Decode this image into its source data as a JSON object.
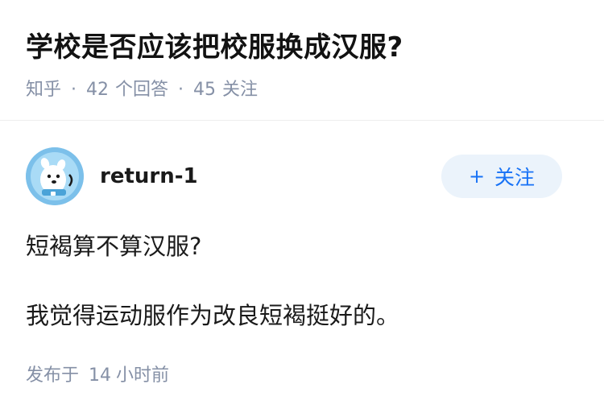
{
  "question": {
    "title": "学校是否应该把校服换成汉服?",
    "source": "知乎",
    "separator": "·",
    "answer_count": "42",
    "answer_label": "个回答",
    "follow_count": "45",
    "follow_label": "关注"
  },
  "answer": {
    "author": "return-1",
    "follow_button": {
      "icon": "+",
      "label": "关注"
    },
    "paragraphs": [
      "短褐算不算汉服?",
      "我觉得运动服作为改良短褐挺好的。"
    ],
    "published_label": "发布于",
    "published_num": "14",
    "published_unit": "小时前"
  },
  "colors": {
    "accent": "#1772f6",
    "follow_bg": "#ebf3fb",
    "meta_text": "#8590a6",
    "avatar_bg": "#8cc9ee"
  }
}
